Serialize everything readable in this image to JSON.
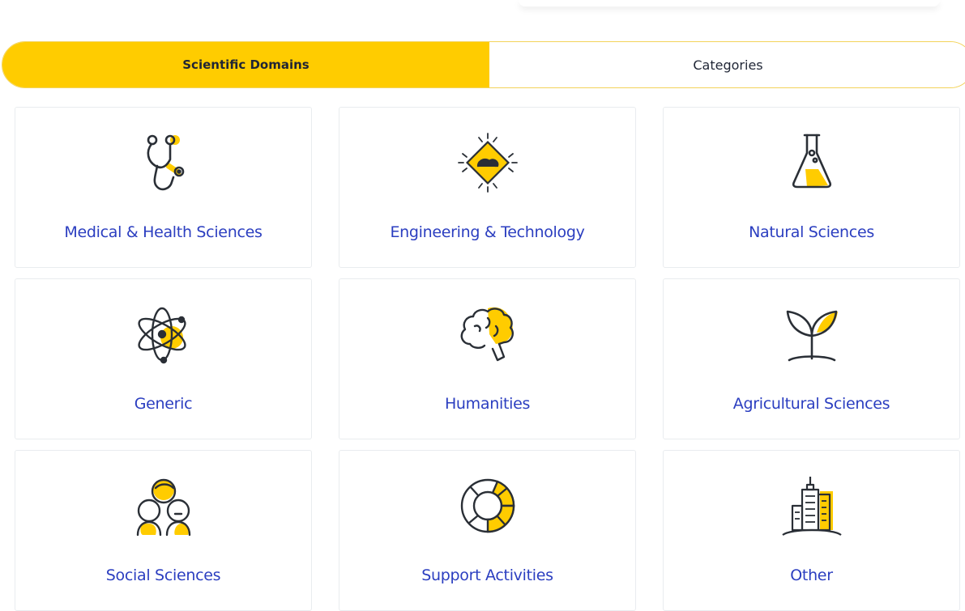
{
  "tabs": [
    {
      "label": "Scientific Domains",
      "active": true
    },
    {
      "label": "Categories",
      "active": false
    }
  ],
  "domains": [
    {
      "label": "Medical & Health Sciences",
      "icon": "stethoscope-icon"
    },
    {
      "label": "Engineering & Technology",
      "icon": "chip-icon"
    },
    {
      "label": "Natural Sciences",
      "icon": "flask-icon"
    },
    {
      "label": "Generic",
      "icon": "atom-icon"
    },
    {
      "label": "Humanities",
      "icon": "brain-icon"
    },
    {
      "label": "Agricultural Sciences",
      "icon": "sprout-icon"
    },
    {
      "label": "Social Sciences",
      "icon": "people-icon"
    },
    {
      "label": "Support Activities",
      "icon": "lifebuoy-icon"
    },
    {
      "label": "Other",
      "icon": "buildings-icon"
    }
  ],
  "colors": {
    "accent": "#ffcc00",
    "link": "#2b3ec0",
    "stroke": "#2a2f36"
  }
}
